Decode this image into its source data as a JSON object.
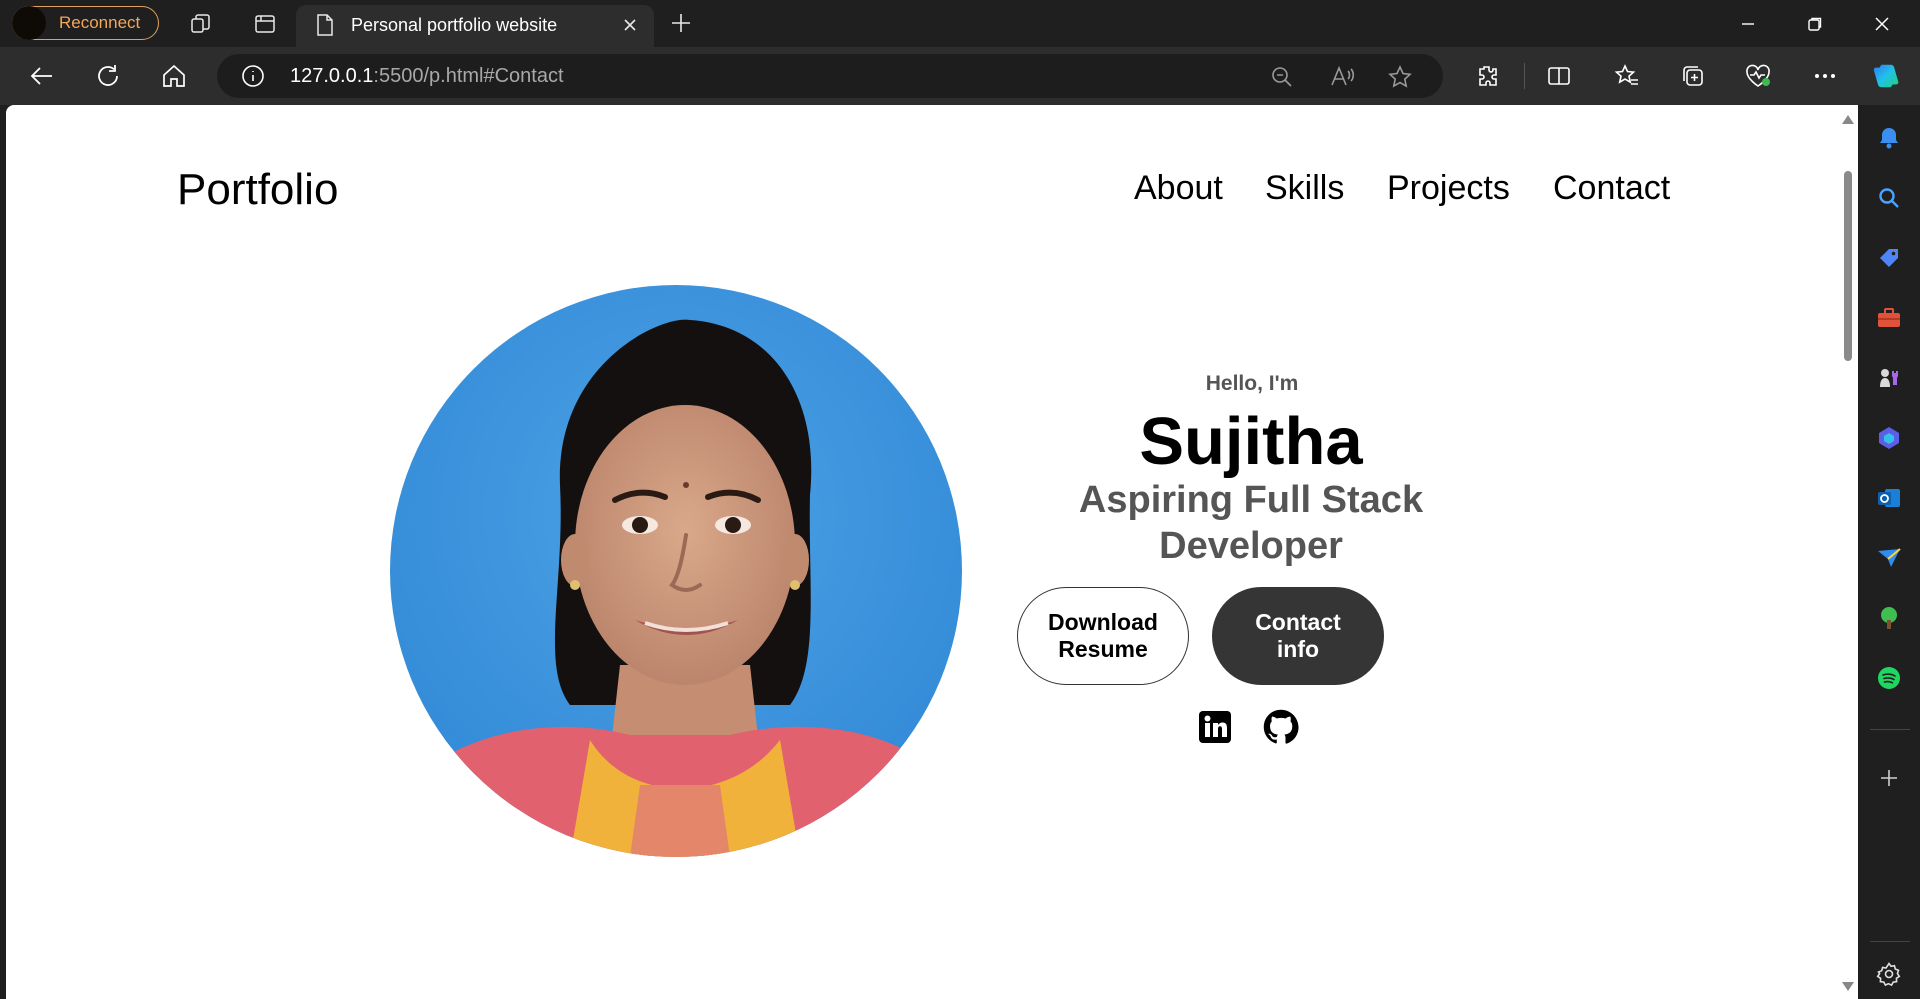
{
  "browser": {
    "reconnect_label": "Reconnect",
    "tab_title": "Personal portfolio website",
    "url_host": "127.0.0.1",
    "url_rest": ":5500/p.html#Contact",
    "titlebar_icons": [
      "workspaces-icon",
      "tab-actions-icon"
    ],
    "toolbar_icons": [
      "extensions-icon",
      "split-screen-icon",
      "favorites-icon",
      "collections-icon",
      "browser-essentials-icon",
      "more-icon",
      "copilot-icon"
    ],
    "sidebar_icons": [
      "notifications-icon",
      "search-icon",
      "shopping-icon",
      "tools-icon",
      "games-icon",
      "m365-icon",
      "outlook-icon",
      "drop-icon",
      "tree-icon",
      "spotify-icon",
      "add-icon",
      "settings-icon"
    ]
  },
  "site": {
    "logo": "Portfolio",
    "nav": [
      "About",
      "Skills",
      "Projects",
      "Contact"
    ],
    "hero": {
      "greeting": "Hello, I'm",
      "name": "Sujitha",
      "role": "Aspiring Full Stack Developer",
      "download_button": "Download Resume",
      "contact_button": "Contact info"
    },
    "social": [
      "linkedin-icon",
      "github-icon"
    ]
  },
  "colors": {
    "accent_reconnect": "#f2a65a",
    "button_dark": "#353535",
    "text_muted": "#555555",
    "photo_bg": "#3a92db"
  }
}
